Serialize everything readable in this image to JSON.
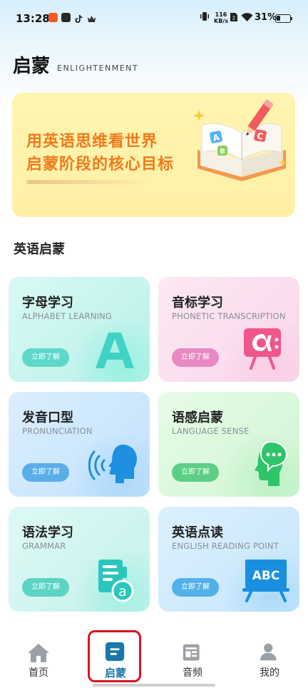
{
  "status_bar": {
    "time": "13:28",
    "net_speed_value": "116",
    "net_speed_unit": "KB/s",
    "battery": "31%",
    "battery_level": 0.31
  },
  "header": {
    "title": "启蒙",
    "subtitle": "ENLIGHTENMENT"
  },
  "banner": {
    "line1": "用英语思维看世界",
    "line2": "启蒙阶段的核心目标"
  },
  "section": {
    "title": "英语启蒙"
  },
  "cards": [
    {
      "title": "字母学习",
      "subtitle": "ALPHABET LEARNING",
      "button": "立即了解",
      "icon": "letter-a-icon",
      "color": "#3fd3c4"
    },
    {
      "title": "音标学习",
      "subtitle": "PHONETIC TRANSCRIPTION",
      "button": "立即了解",
      "icon": "phonetic-board-icon",
      "color": "#f0568a"
    },
    {
      "title": "发音口型",
      "subtitle": "PRONUNCIATION",
      "button": "立即了解",
      "icon": "speaking-head-icon",
      "color": "#1f8fe0"
    },
    {
      "title": "语感启蒙",
      "subtitle": "LANGUAGE SENSE",
      "button": "立即了解",
      "icon": "thinking-head-icon",
      "color": "#2fc46a"
    },
    {
      "title": "语法学习",
      "subtitle": "GRAMMAR",
      "button": "立即了解",
      "icon": "grammar-document-icon",
      "color": "#2bc6bb"
    },
    {
      "title": "英语点读",
      "subtitle": "ENGLISH READING POINT",
      "button": "立即了解",
      "icon": "abc-board-icon",
      "color": "#1a8fe0"
    }
  ],
  "bottom_nav": {
    "items": [
      {
        "label": "首页",
        "icon": "home-icon"
      },
      {
        "label": "启蒙",
        "icon": "enlightenment-icon",
        "active": true
      },
      {
        "label": "音频",
        "icon": "audio-icon"
      },
      {
        "label": "我的",
        "icon": "profile-icon"
      }
    ],
    "active_index": 1
  },
  "colors": {
    "accent": "#1a78a8",
    "banner_text": "#f07a1c",
    "highlight": "#d8141d"
  }
}
